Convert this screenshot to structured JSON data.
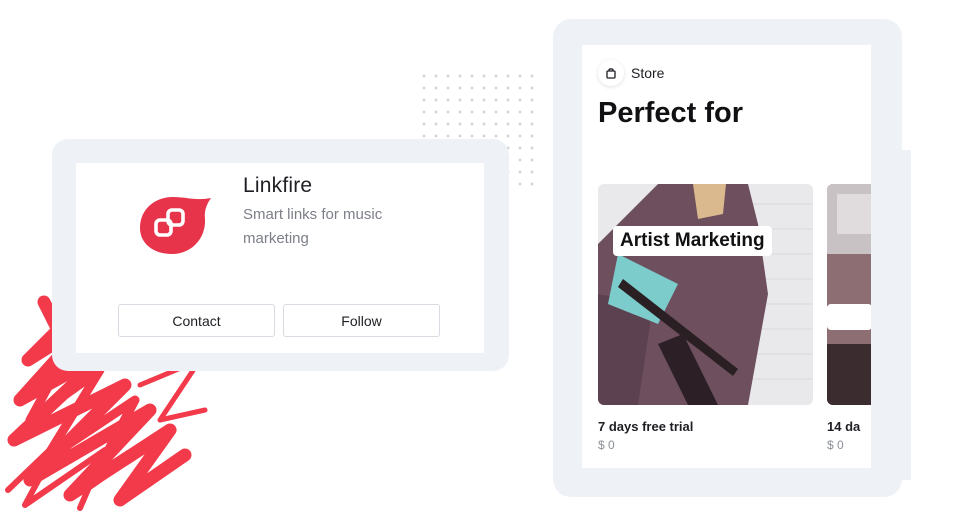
{
  "profile": {
    "name": "Linkfire",
    "description": "Smart links for music marketing",
    "contact_label": "Contact",
    "follow_label": "Follow",
    "logo_icon": "linkfire-logo-icon",
    "brand_color": "#e8344a"
  },
  "store": {
    "tag_icon": "shopping-bag-icon",
    "tag_label": "Store",
    "title": "Perfect for",
    "products": [
      {
        "caption": "Artist Marketing",
        "name": "7 days free trial",
        "price": "$ 0"
      },
      {
        "caption": "",
        "name": "14 da",
        "price": "$ 0"
      }
    ]
  },
  "colors": {
    "frame_background": "#eef1f6",
    "accent_red": "#f03b4d"
  }
}
